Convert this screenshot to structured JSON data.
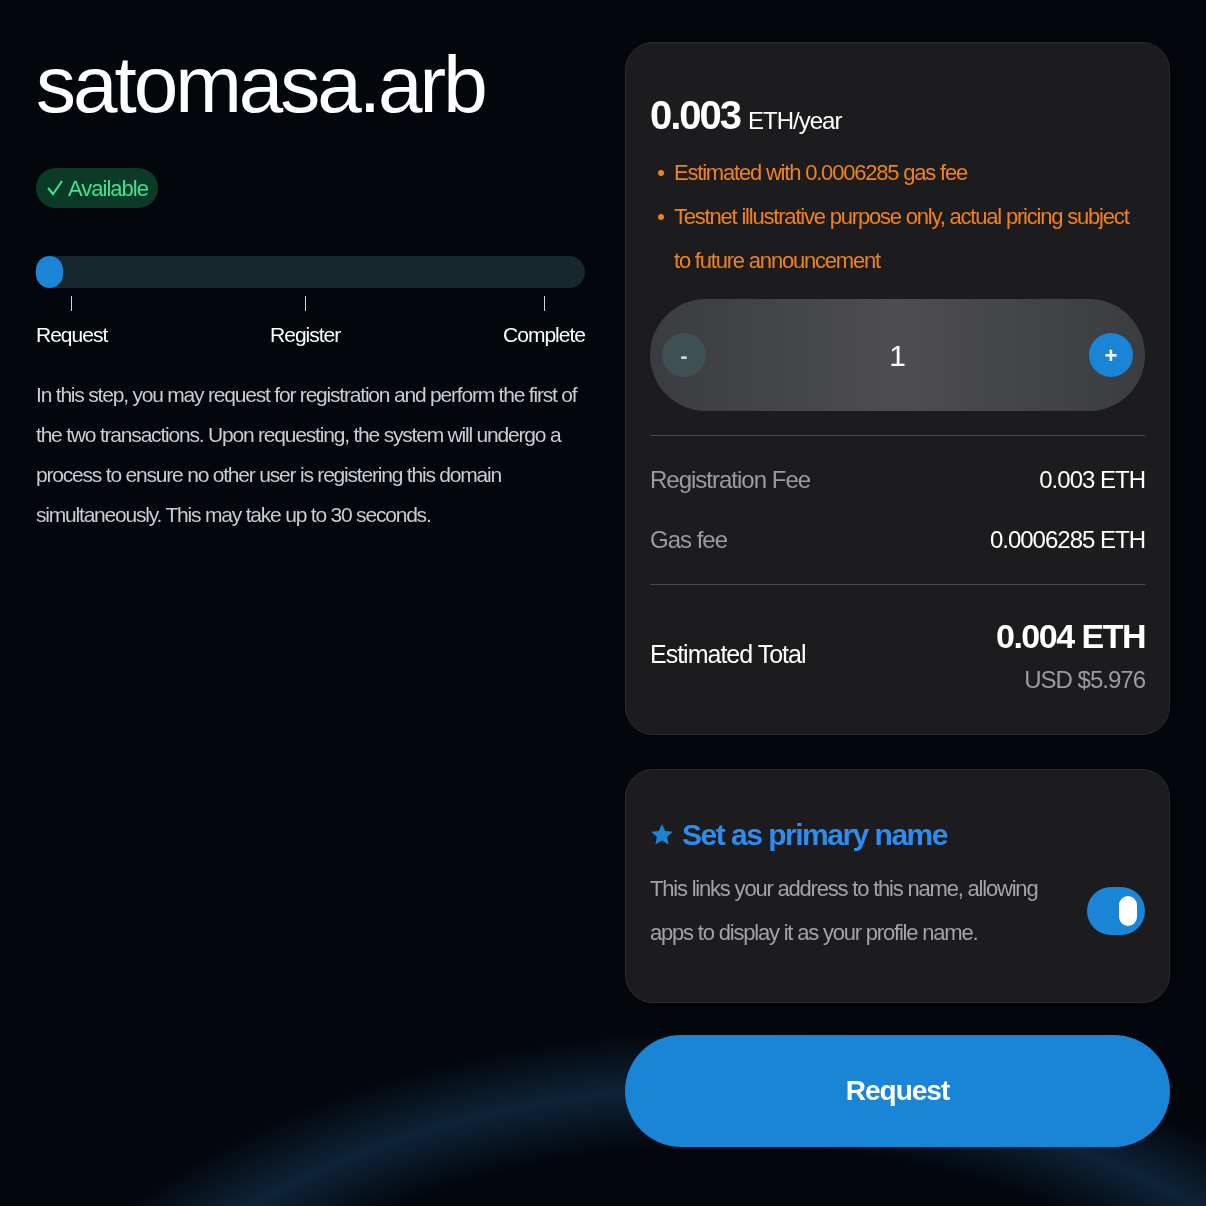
{
  "domain": "satomasa.arb",
  "status": {
    "label": "Available",
    "available": true
  },
  "progress": {
    "level": 0.05,
    "steps": [
      "Request",
      "Register",
      "Complete"
    ]
  },
  "description": "In this step, you may request for registration and perform the first of the two transactions. Upon requesting, the system will undergo a process to ensure no other user is registering this domain simultaneously. This may take up to 30 seconds.",
  "price": {
    "amount": "0.003",
    "unit": "ETH/year",
    "notes": [
      "Estimated with 0.0006285 gas fee",
      "Testnet illustrative purpose only, actual pricing subject to future announcement"
    ]
  },
  "stepper": {
    "minus": "-",
    "value": "1",
    "plus": "+",
    "minus_disabled": true
  },
  "fees": [
    {
      "label": "Registration Fee",
      "value": "0.003 ETH"
    },
    {
      "label": "Gas fee",
      "value": "0.0006285 ETH"
    }
  ],
  "total": {
    "label": "Estimated Total",
    "eth": "0.004 ETH",
    "usd": "USD $5.976"
  },
  "primary": {
    "title": "Set as primary name",
    "description": "This links your address to this name, allowing apps to display it as your profile name.",
    "on": true
  },
  "button": "Request"
}
